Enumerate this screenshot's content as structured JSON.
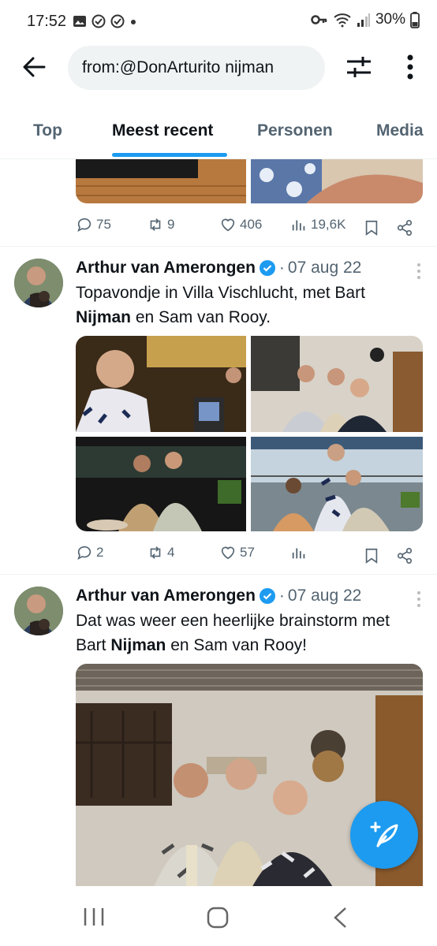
{
  "status_bar": {
    "time": "17:52",
    "battery": "30%"
  },
  "search": {
    "query": "from:@DonArturito nijman"
  },
  "tabs": [
    {
      "label": "Top"
    },
    {
      "label": "Meest recent",
      "active": true
    },
    {
      "label": "Personen"
    },
    {
      "label": "Media"
    }
  ],
  "prev_tweet": {
    "replies": "75",
    "retweets": "9",
    "likes": "406",
    "views": "19,6K"
  },
  "tweets": [
    {
      "author": "Arthur van Amerongen",
      "verified": true,
      "separator": "·",
      "date": "07 aug 22",
      "text_parts": [
        "Topavondje in Villa Vischlucht, met Bart ",
        "Nijman",
        " en Sam van Rooy."
      ],
      "replies": "2",
      "retweets": "4",
      "likes": "57",
      "views": ""
    },
    {
      "author": "Arthur van Amerongen",
      "verified": true,
      "separator": "·",
      "date": "07 aug 22",
      "text_parts": [
        "Dat was weer een heerlijke brainstorm met Bart ",
        "Nijman",
        " en Sam van Rooy!"
      ]
    }
  ],
  "colors": {
    "accent": "#1d9bf0",
    "text_primary": "#0f1419",
    "text_secondary": "#536471",
    "search_bg": "#eff3f4"
  },
  "icons": {
    "back": "arrow-left-icon",
    "filter": "sliders-icon",
    "more": "more-vertical-icon",
    "reply": "reply-icon",
    "retweet": "retweet-icon",
    "like": "heart-icon",
    "views": "bar-chart-icon",
    "bookmark": "bookmark-icon",
    "share": "share-icon",
    "compose": "compose-feather-icon"
  }
}
